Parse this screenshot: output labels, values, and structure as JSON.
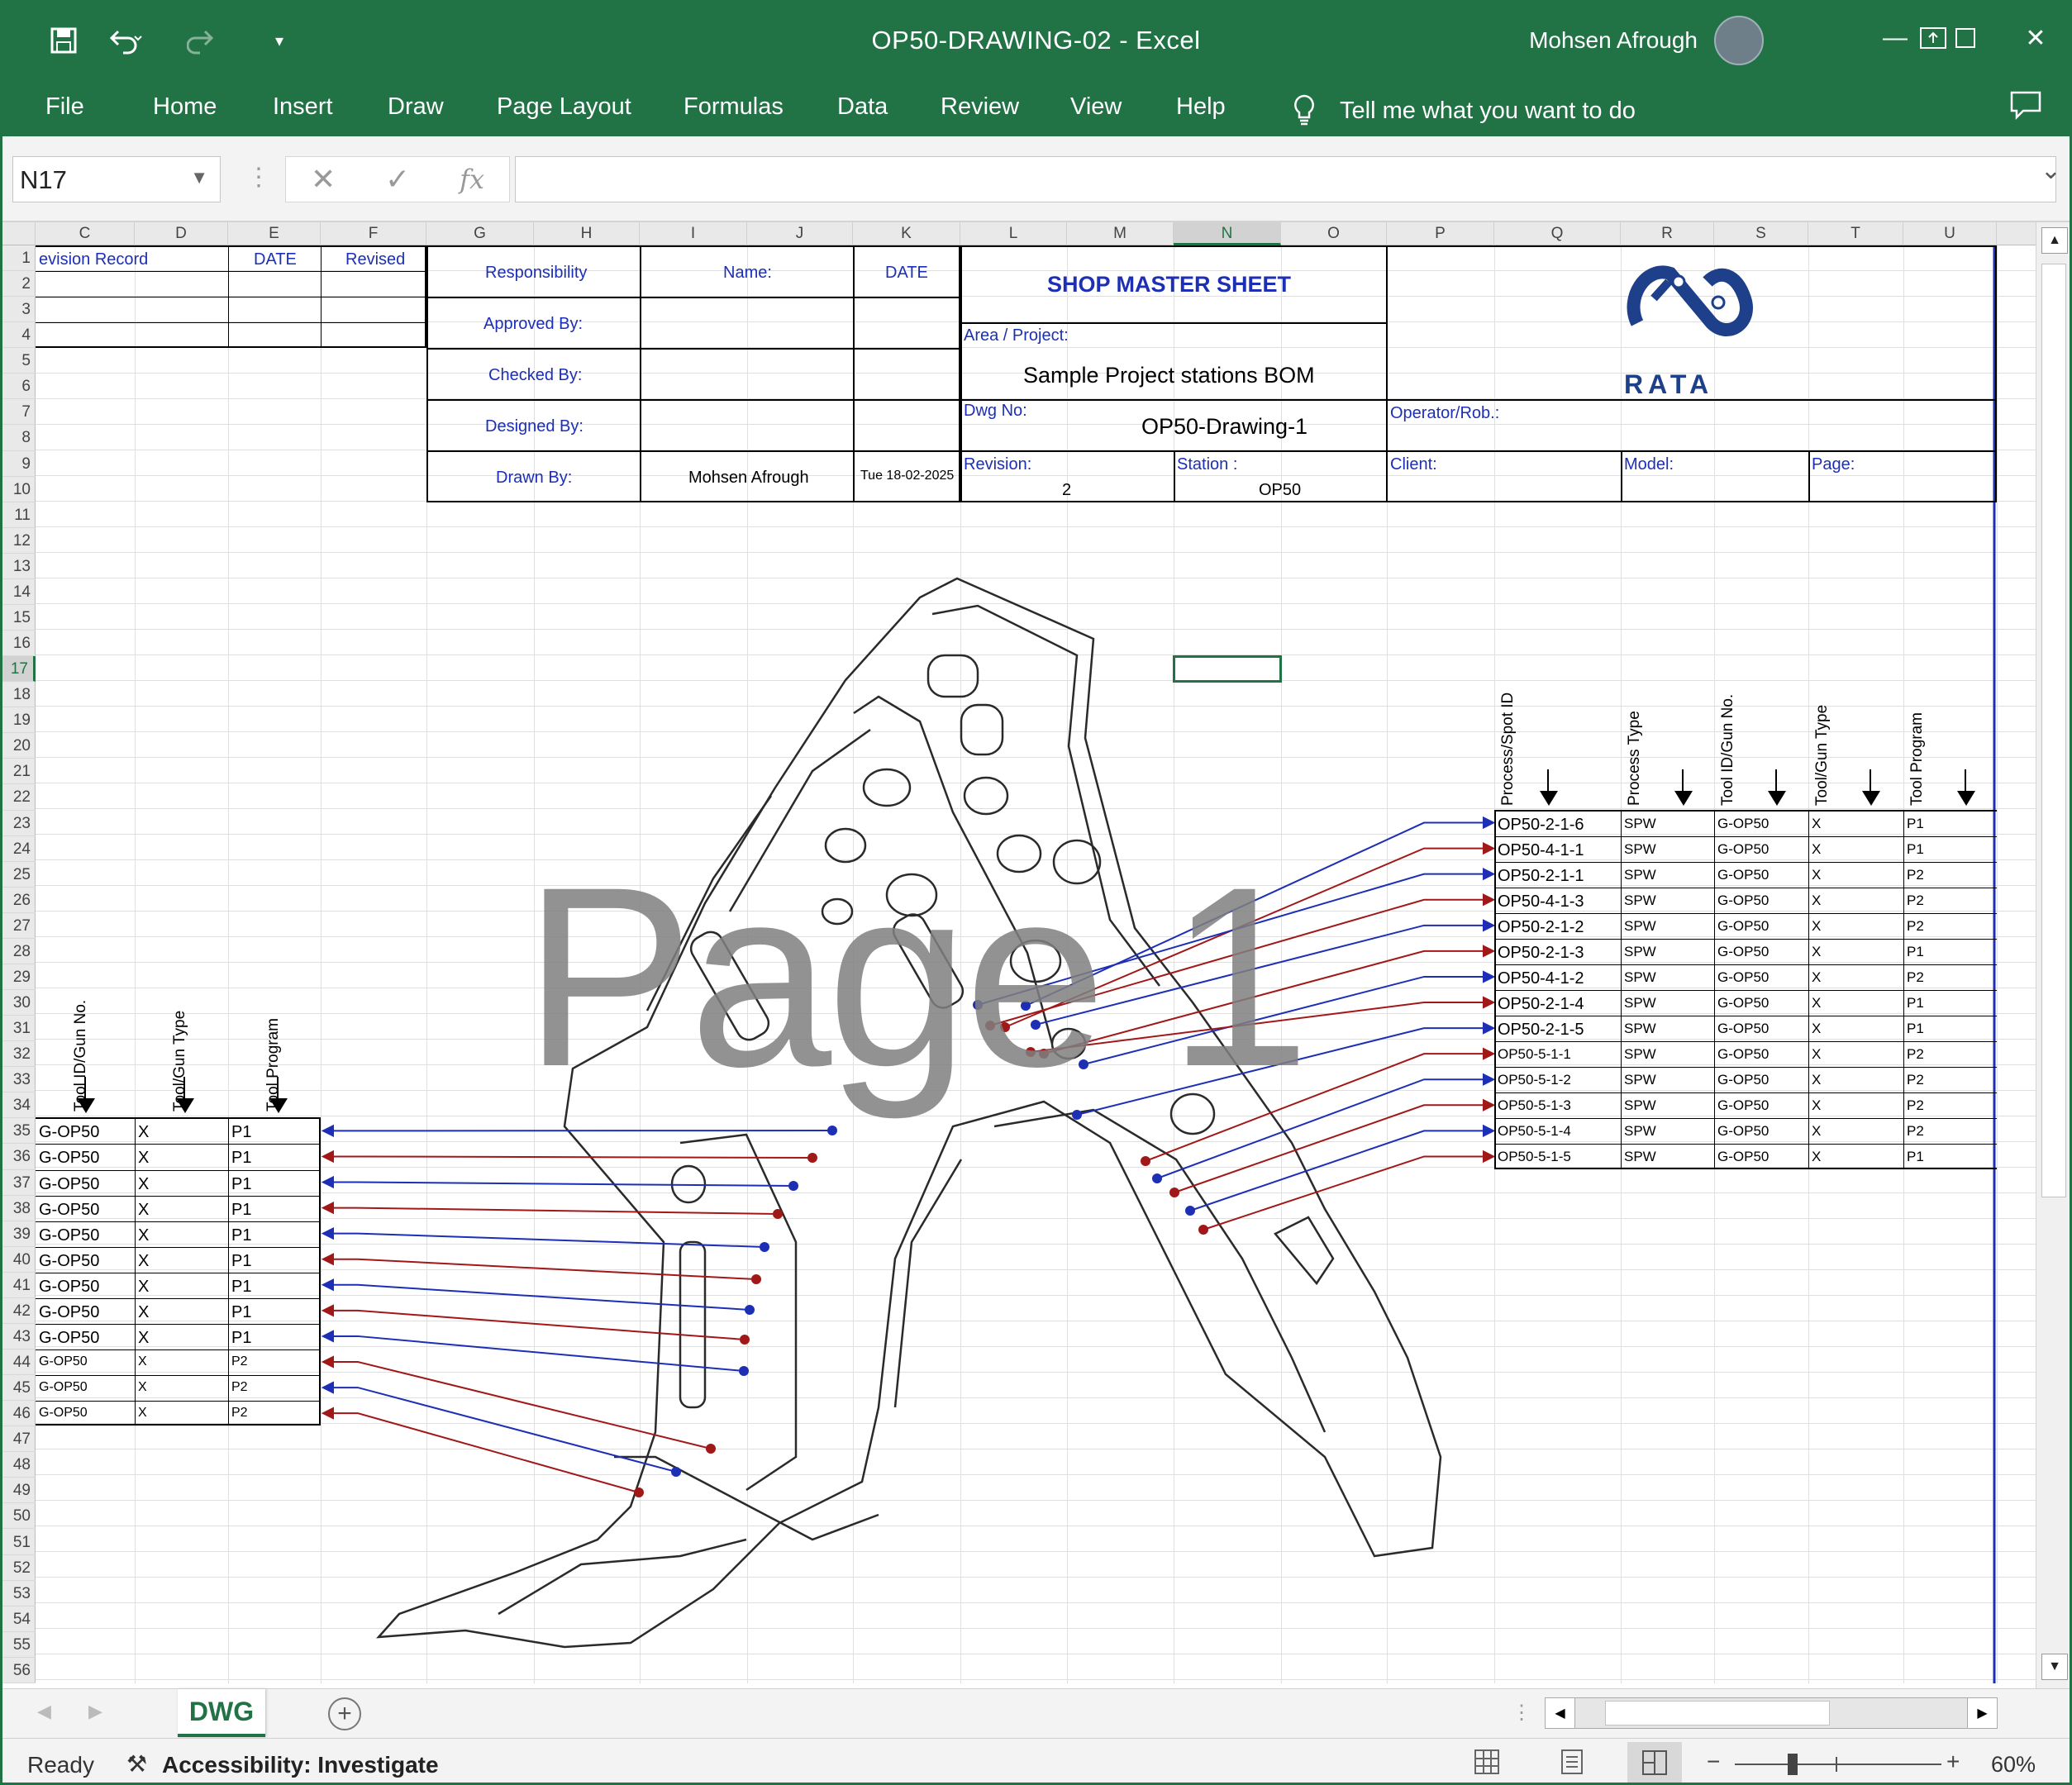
{
  "window": {
    "title": "OP50-DRAWING-02  -  Excel",
    "user": "Mohsen Afrough"
  },
  "ribbon": {
    "tabs": [
      "File",
      "Home",
      "Insert",
      "Draw",
      "Page Layout",
      "Formulas",
      "Data",
      "Review",
      "View",
      "Help"
    ],
    "tell_me": "Tell me what you want to do"
  },
  "formula_bar": {
    "name_box": "N17",
    "fx": "fx",
    "value": ""
  },
  "columns": [
    "C",
    "D",
    "E",
    "F",
    "G",
    "H",
    "I",
    "J",
    "K",
    "L",
    "M",
    "N",
    "O",
    "P",
    "Q",
    "R",
    "S",
    "T",
    "U"
  ],
  "rows": [
    "1",
    "2",
    "3",
    "4",
    "5",
    "6",
    "7",
    "8",
    "9",
    "10",
    "11",
    "12",
    "13",
    "14",
    "15",
    "16",
    "17",
    "18",
    "19",
    "20",
    "21",
    "22",
    "23",
    "24",
    "25",
    "26",
    "27",
    "28",
    "29",
    "30",
    "31",
    "32",
    "33",
    "34",
    "35",
    "36",
    "37",
    "38",
    "39",
    "40",
    "41",
    "42",
    "43",
    "44",
    "45",
    "46",
    "47",
    "48",
    "49",
    "50",
    "51",
    "52",
    "53",
    "54",
    "55",
    "56"
  ],
  "revision_block": {
    "revision_record": "evision Record",
    "date": "DATE",
    "revised": "Revised"
  },
  "title_block": {
    "responsibility": "Responsibility",
    "name_label": "Name:",
    "date_label": "DATE",
    "approved_by": "Approved By:",
    "checked_by": "Checked By:",
    "designed_by": "Designed By:",
    "drawn_by": "Drawn By:",
    "drawn_name": "Mohsen Afrough",
    "drawn_date": "Tue 18-02-2025",
    "sheet_title": "SHOP MASTER SHEET",
    "area_label": "Area / Project:",
    "area_value": "Sample Project stations BOM",
    "dwg_label": "Dwg No:",
    "dwg_value": "OP50-Drawing-1",
    "revision_label": "Revision:",
    "revision_value": "2",
    "station_label": "Station :",
    "station_value": "OP50",
    "operator_label": "Operator/Rob.:",
    "client_label": "Client:",
    "model_label": "Model:",
    "page_label": "Page:",
    "logo_text": "RATA"
  },
  "watermark": "Page 1",
  "right_table": {
    "headers": [
      "Process/Spot ID",
      "Process Type",
      "Tool ID/Gun No.",
      "Tool/Gun Type",
      "Tool Program"
    ],
    "rows": [
      [
        "OP50-2-1-6",
        "SPW",
        "G-OP50",
        "X",
        "P1"
      ],
      [
        "OP50-4-1-1",
        "SPW",
        "G-OP50",
        "X",
        "P1"
      ],
      [
        "OP50-2-1-1",
        "SPW",
        "G-OP50",
        "X",
        "P2"
      ],
      [
        "OP50-4-1-3",
        "SPW",
        "G-OP50",
        "X",
        "P2"
      ],
      [
        "OP50-2-1-2",
        "SPW",
        "G-OP50",
        "X",
        "P2"
      ],
      [
        "OP50-2-1-3",
        "SPW",
        "G-OP50",
        "X",
        "P1"
      ],
      [
        "OP50-4-1-2",
        "SPW",
        "G-OP50",
        "X",
        "P2"
      ],
      [
        "OP50-2-1-4",
        "SPW",
        "G-OP50",
        "X",
        "P1"
      ],
      [
        "OP50-2-1-5",
        "SPW",
        "G-OP50",
        "X",
        "P1"
      ],
      [
        "OP50-5-1-1",
        "SPW",
        "G-OP50",
        "X",
        "P2"
      ],
      [
        "OP50-5-1-2",
        "SPW",
        "G-OP50",
        "X",
        "P2"
      ],
      [
        "OP50-5-1-3",
        "SPW",
        "G-OP50",
        "X",
        "P2"
      ],
      [
        "OP50-5-1-4",
        "SPW",
        "G-OP50",
        "X",
        "P2"
      ],
      [
        "OP50-5-1-5",
        "SPW",
        "G-OP50",
        "X",
        "P1"
      ]
    ]
  },
  "left_table": {
    "headers": [
      "Tool ID/Gun No.",
      "Tool/Gun Type",
      "Tool Program"
    ],
    "rows": [
      [
        "G-OP50",
        "X",
        "P1"
      ],
      [
        "G-OP50",
        "X",
        "P1"
      ],
      [
        "G-OP50",
        "X",
        "P1"
      ],
      [
        "G-OP50",
        "X",
        "P1"
      ],
      [
        "G-OP50",
        "X",
        "P1"
      ],
      [
        "G-OP50",
        "X",
        "P1"
      ],
      [
        "G-OP50",
        "X",
        "P1"
      ],
      [
        "G-OP50",
        "X",
        "P1"
      ],
      [
        "G-OP50",
        "X",
        "P1"
      ],
      [
        "G-OP50",
        "X",
        "P2"
      ],
      [
        "G-OP50",
        "X",
        "P2"
      ],
      [
        "G-OP50",
        "X",
        "P2"
      ]
    ]
  },
  "sheet_tabs": {
    "active": "DWG",
    "add": "+"
  },
  "status": {
    "ready": "Ready",
    "accessibility": "Accessibility: Investigate",
    "zoom": "60%"
  },
  "colors": {
    "brand": "#217346",
    "blue_leader": "#1c2fb5",
    "red_leader": "#a11818"
  }
}
